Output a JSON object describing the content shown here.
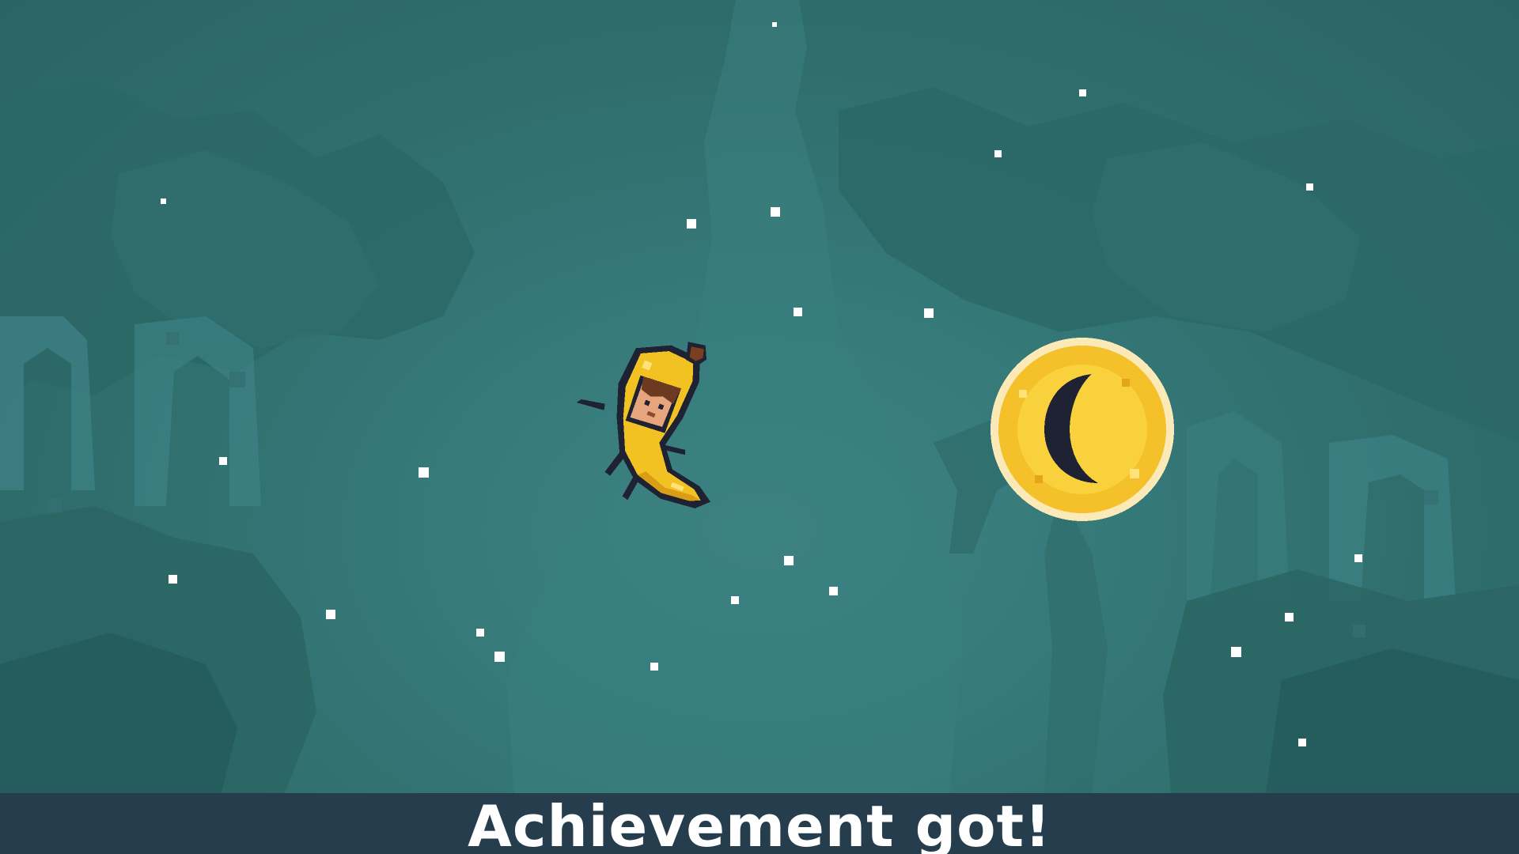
{
  "banner": {
    "text": "Achievement got!"
  },
  "scene": {
    "player_icon": "banana-costume-character-icon",
    "pickup_icon": "moon-coin-icon"
  },
  "colors": {
    "background": "#2f6e6c",
    "banner": "#253d4d",
    "banner_text": "#ffffff",
    "coin_gold": "#f5c12a",
    "coin_moon": "#1f2233",
    "banana_yellow": "#f2c222",
    "banana_stem": "#7a3f1f"
  }
}
